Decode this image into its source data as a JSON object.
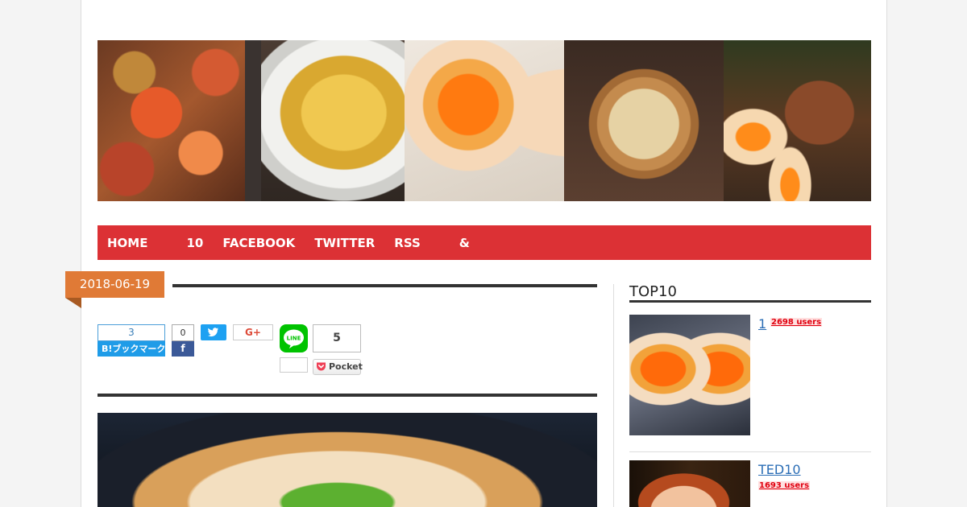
{
  "nav": {
    "items": [
      "HOME",
      "10",
      "FACEBOOK",
      "TWITTER",
      "RSS",
      "&"
    ]
  },
  "article": {
    "date": "2018-06-19"
  },
  "share": {
    "hatena_count": "3",
    "hatena_label": "B!ブックマーク",
    "facebook_count": "0",
    "facebook_icon": "f",
    "googleplus_label": "G+",
    "line_label": "LINE",
    "pocket_count": "5",
    "pocket_label": "Pocket"
  },
  "sidebar": {
    "title": "TOP10",
    "ranking": [
      {
        "title": "1",
        "users": "2698 users"
      },
      {
        "title": "TED10",
        "users": "1693 users"
      }
    ]
  },
  "colors": {
    "nav_bg": "#dc3135",
    "date_badge": "#e07a36",
    "link": "#2a6db5",
    "users_badge": "#e0000f"
  }
}
